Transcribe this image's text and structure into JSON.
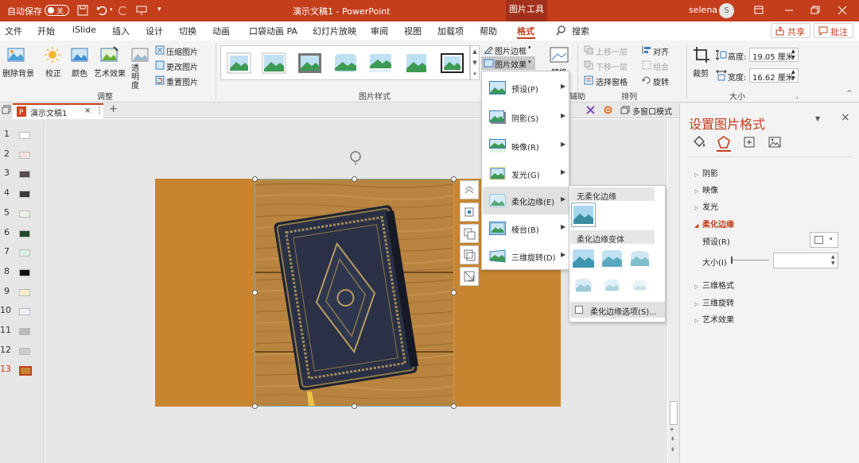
{
  "titlebar": {
    "autosave_label": "自动保存",
    "autosave_state": "关",
    "doc_title": "演示文稿1 - PowerPoint",
    "tool_context": "图片工具",
    "user": "selena",
    "avatar_letter": "S"
  },
  "tabs": [
    {
      "label": "文件"
    },
    {
      "label": "开始"
    },
    {
      "label": "iSlide"
    },
    {
      "label": "插入"
    },
    {
      "label": "设计"
    },
    {
      "label": "切换"
    },
    {
      "label": "动画"
    },
    {
      "label": "口袋动画 PA"
    },
    {
      "label": "幻灯片放映"
    },
    {
      "label": "审阅"
    },
    {
      "label": "视图"
    },
    {
      "label": "加载项"
    },
    {
      "label": "帮助"
    },
    {
      "label": "格式"
    }
  ],
  "search_label": "搜索",
  "share_label": "共享",
  "comment_label": "批注",
  "ribbon": {
    "remove_bg": "删除背景",
    "correct": "校正",
    "color": "颜色",
    "art_effect": "艺术效果",
    "transparency": "透明度",
    "compress": "压缩图片",
    "change": "更改图片",
    "reset": "重置图片",
    "group_adjust": "调整",
    "group_styles": "图片样式",
    "border": "图片边框",
    "effects": "图片效果",
    "bring_forward": "上移一层",
    "send_backward": "下移一层",
    "selection_pane": "选择窗格",
    "align": "对齐",
    "group_obj": "组合",
    "rotate": "旋转",
    "group_arrange": "排列",
    "crop": "裁剪",
    "height_label": "高度:",
    "height_value": "19.05 厘米",
    "width_label": "宽度:",
    "width_value": "16.62 厘米",
    "group_size": "大小",
    "group_partial": "辅助"
  },
  "doc_tab": "演示文稿1",
  "multi_window": "多窗口模式",
  "slides": [
    "1",
    "2",
    "3",
    "4",
    "5",
    "6",
    "7",
    "8",
    "9",
    "10",
    "11",
    "12",
    "13"
  ],
  "current_slide": "13",
  "effects_menu": [
    {
      "label": "预设(P)"
    },
    {
      "label": "阴影(S)"
    },
    {
      "label": "映像(R)"
    },
    {
      "label": "发光(G)"
    },
    {
      "label": "柔化边缘(E)"
    },
    {
      "label": "棱台(B)"
    },
    {
      "label": "三维旋转(D)"
    }
  ],
  "soft_edge_sub": {
    "no_soft": "无柔化边缘",
    "variants": "柔化边缘变体",
    "options": "柔化边缘选项(S)..."
  },
  "panel": {
    "title": "设置图片格式",
    "items": [
      "阴影",
      "映像",
      "发光",
      "柔化边缘",
      "三维格式",
      "三维旋转",
      "艺术效果"
    ],
    "preset_label": "预设(R)",
    "size_label": "大小(I)"
  },
  "colors": {
    "accent": "#c43e1c",
    "slide_bg": "#c88530"
  }
}
